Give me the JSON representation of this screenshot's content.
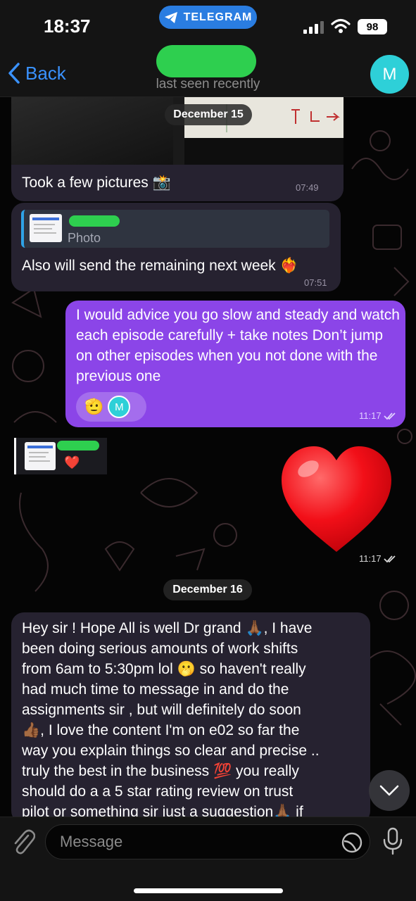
{
  "status_bar": {
    "time": "18:37",
    "app_pill": "TELEGRAM",
    "battery": "98"
  },
  "header": {
    "back_label": "Back",
    "last_seen": "last seen recently",
    "avatar_letter": "M"
  },
  "messages": [
    {
      "date": "December 15"
    },
    {
      "text": "Took a few pictures 📸",
      "time": "07:49"
    },
    {
      "reply_label": "Photo",
      "text": "Also will send the remaining next week ❤️‍🔥",
      "time": "07:51"
    },
    {
      "text": "I would advice you go slow and steady and watch each episode carefully + take notes Don’t jump on other episodes when you not done with the previous one",
      "reaction_emoji": "🫡",
      "reaction_avatar": "M",
      "time": "11:17"
    },
    {
      "sticker_reply_heart": "❤️",
      "sticker": "❤️",
      "time": "11:17"
    },
    {
      "date": "December 16"
    },
    {
      "text_lines": [
        "Hey sir ! Hope All is well Dr grand 🙏🏾,  I have",
        "been doing serious amounts of work shifts",
        "from 6am to 5:30pm lol 🫢 so haven't really",
        "had much time to message in and do the",
        "assignments sir , but will definitely do soon",
        "👍🏾,  I love the content I'm on e02 so far the",
        "way you explain things so clear and precise ..",
        "truly the best in the business 💯 you really",
        "should do a a 5 star rating review on trust",
        "pilot or something sir just a suggestion🙏🏾 if"
      ]
    }
  ],
  "input": {
    "placeholder": "Message"
  },
  "colors": {
    "accent": "#3a92ff",
    "outgoing_bubble": "#8b45e8",
    "incoming_bubble": "#262230",
    "telegram_pill": "#2a7de1",
    "avatar": "#2ed0d8",
    "redaction": "#2ecf4f"
  },
  "icons": [
    "telegram-icon",
    "signal-icon",
    "wifi-icon",
    "chevron-left-icon",
    "double-check-icon",
    "chevron-down-icon",
    "paperclip-icon",
    "sticker-icon",
    "microphone-icon"
  ]
}
